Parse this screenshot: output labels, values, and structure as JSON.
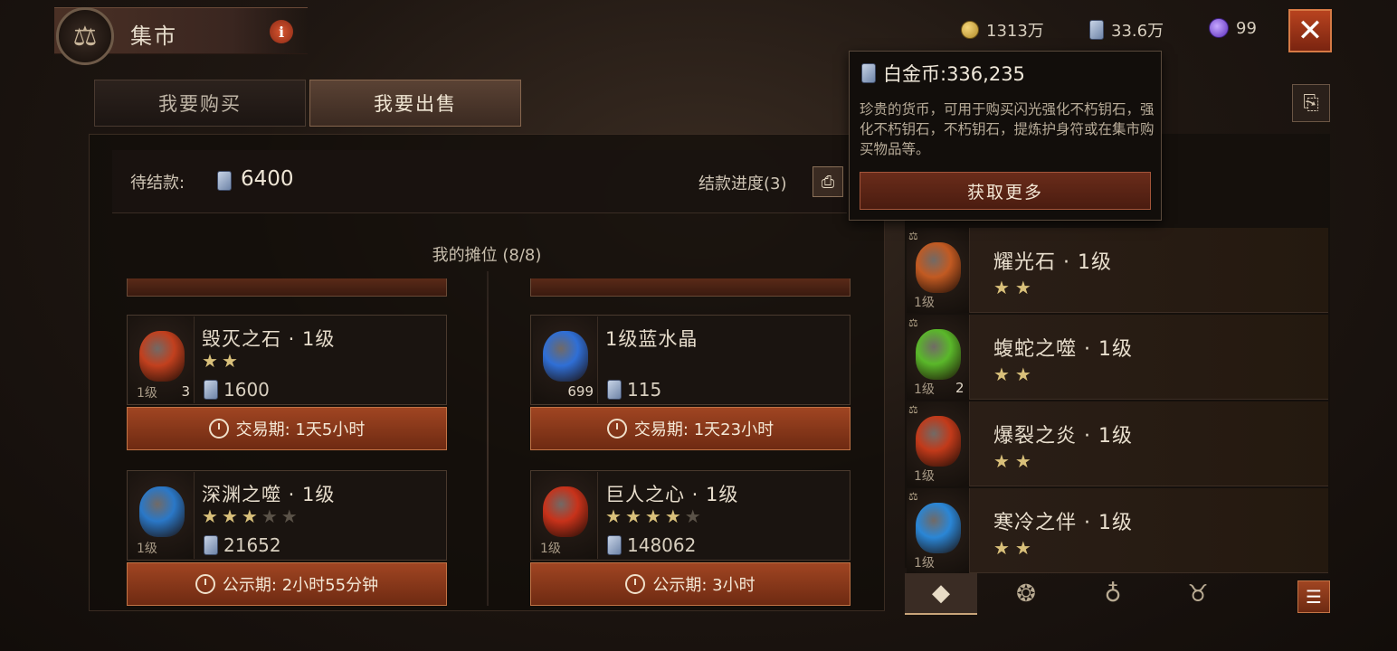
{
  "header": {
    "title": "集市",
    "gold": "1313万",
    "platinum": "33.6万",
    "orbs": "99"
  },
  "tabs": {
    "buy": "我要购买",
    "sell": "我要出售",
    "active": "sell"
  },
  "pending": {
    "label": "待结款:",
    "value": "6400",
    "progress_label": "结款进度(3)"
  },
  "stall": {
    "title": "我的摊位 (8/8)",
    "cards": [
      {
        "name": "毁灭之石 · 1级",
        "stars_on": 2,
        "stars_total": 2,
        "level": "1级",
        "count": "3",
        "price": "1600",
        "timer": "交易期:  1天5小时",
        "gem_color": "#c2401e"
      },
      {
        "name": "1级蓝水晶",
        "stars_on": 0,
        "stars_total": 0,
        "level": "",
        "count": "699",
        "price": "115",
        "timer": "交易期:  1天23小时",
        "gem_color": "#2f6fd6"
      },
      {
        "name": "深渊之噬 · 1级",
        "stars_on": 3,
        "stars_total": 5,
        "level": "1级",
        "count": "",
        "price": "21652",
        "timer": "公示期:  2小时55分钟",
        "gem_color": "#2a78c8"
      },
      {
        "name": "巨人之心 · 1级",
        "stars_on": 4,
        "stars_total": 5,
        "level": "1级",
        "count": "",
        "price": "148062",
        "timer": "公示期:  3小时",
        "gem_color": "#c8321a"
      }
    ]
  },
  "right_list": [
    {
      "name": "耀光石 · 1级",
      "stars": "★★",
      "level": "1级",
      "count": "",
      "gem_color": "#c25a22"
    },
    {
      "name": "蝮蛇之噬 · 1级",
      "stars": "★★",
      "level": "1级",
      "count": "2",
      "gem_color": "#5ab82a"
    },
    {
      "name": "爆裂之炎 · 1级",
      "stars": "★★",
      "level": "1级",
      "count": "",
      "gem_color": "#c23a1a"
    },
    {
      "name": "寒冷之伴 · 1级",
      "stars": "★★",
      "level": "1级",
      "count": "",
      "gem_color": "#2a86d6"
    }
  ],
  "tooltip": {
    "title": "白金币:336,235",
    "description": "珍贵的货币，可用于购买闪光强化不朽钥石，强化不朽钥石，不朽钥石，提炼护身符或在集市购买物品等。",
    "button": "获取更多"
  },
  "icons": {
    "emblem": "scales-icon",
    "close": "close-icon",
    "bottom_tabs": [
      "gem-icon",
      "dragon-icon",
      "bag-icon",
      "demon-icon"
    ],
    "list": "list-icon"
  }
}
